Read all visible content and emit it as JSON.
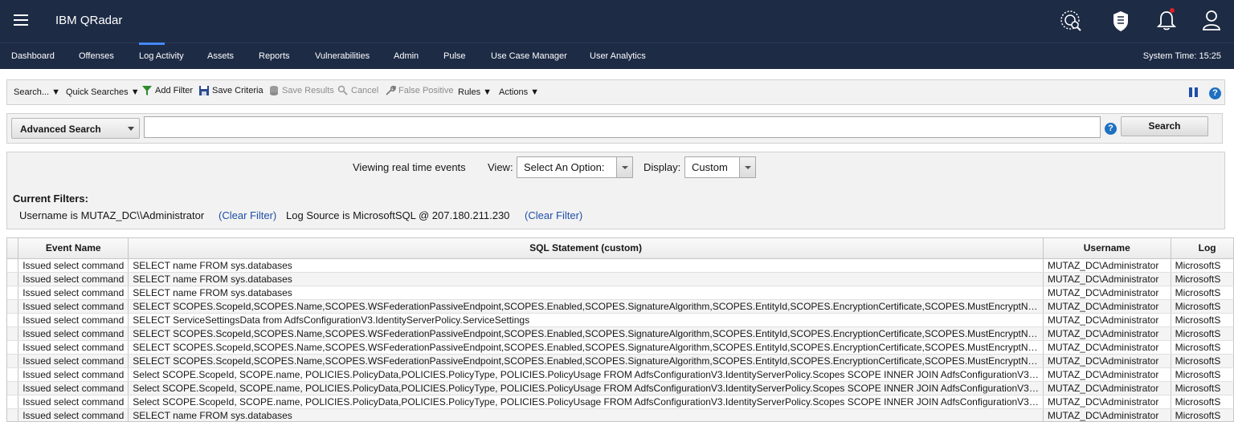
{
  "app": {
    "title": "IBM QRadar"
  },
  "header_icons": [
    "watson-globe-icon",
    "security-shield-icon",
    "notification-bell-icon",
    "user-profile-icon"
  ],
  "nav": {
    "items": [
      "Dashboard",
      "Offenses",
      "Log Activity",
      "Assets",
      "Reports",
      "Vulnerabilities",
      "Admin",
      "Pulse",
      "Use Case Manager",
      "User Analytics"
    ],
    "active": "Log Activity",
    "system_time": "System Time: 15:25"
  },
  "toolbar": {
    "search": "Search... ▼",
    "quick_searches": "Quick Searches ▼",
    "add_filter": "Add Filter",
    "save_criteria": "Save Criteria",
    "save_results": "Save Results",
    "cancel": "Cancel",
    "false_positive": "False Positive",
    "rules": "Rules ▼",
    "actions": "Actions ▼"
  },
  "search_bar": {
    "mode": "Advanced Search",
    "query": "",
    "button": "Search",
    "help": "?"
  },
  "filters": {
    "status": "Viewing real time events",
    "view_label": "View:",
    "view_value": "Select An Option:",
    "display_label": "Display:",
    "display_value": "Custom",
    "current_label": "Current Filters:",
    "filter1": "Username is MUTAZ_DC\\\\Administrator",
    "filter2": "Log Source is MicrosoftSQL @ 207.180.211.230",
    "clear": "(Clear Filter)"
  },
  "table": {
    "columns": [
      "Event Name",
      "SQL Statement (custom)",
      "Username",
      "Log"
    ],
    "rows": [
      [
        "Issued select command",
        "SELECT name FROM sys.databases",
        "MUTAZ_DC\\Administrator",
        "MicrosoftS"
      ],
      [
        "Issued select command",
        "SELECT name FROM sys.databases",
        "MUTAZ_DC\\Administrator",
        "MicrosoftS"
      ],
      [
        "Issued select command",
        "SELECT name FROM sys.databases",
        "MUTAZ_DC\\Administrator",
        "MicrosoftS"
      ],
      [
        "Issued select command",
        "SELECT SCOPES.ScopeId,SCOPES.Name,SCOPES.WSFederationPassiveEndpoint,SCOPES.Enabled,SCOPES.SignatureAlgorithm,SCOPES.EntityId,SCOPES.EncryptionCertificate,SCOPES.MustEncryptN…",
        "MUTAZ_DC\\Administrator",
        "MicrosoftS"
      ],
      [
        "Issued select command",
        "SELECT ServiceSettingsData from AdfsConfigurationV3.IdentityServerPolicy.ServiceSettings",
        "MUTAZ_DC\\Administrator",
        "MicrosoftS"
      ],
      [
        "Issued select command",
        "SELECT SCOPES.ScopeId,SCOPES.Name,SCOPES.WSFederationPassiveEndpoint,SCOPES.Enabled,SCOPES.SignatureAlgorithm,SCOPES.EntityId,SCOPES.EncryptionCertificate,SCOPES.MustEncryptN…",
        "MUTAZ_DC\\Administrator",
        "MicrosoftS"
      ],
      [
        "Issued select command",
        "SELECT SCOPES.ScopeId,SCOPES.Name,SCOPES.WSFederationPassiveEndpoint,SCOPES.Enabled,SCOPES.SignatureAlgorithm,SCOPES.EntityId,SCOPES.EncryptionCertificate,SCOPES.MustEncryptN…",
        "MUTAZ_DC\\Administrator",
        "MicrosoftS"
      ],
      [
        "Issued select command",
        "SELECT SCOPES.ScopeId,SCOPES.Name,SCOPES.WSFederationPassiveEndpoint,SCOPES.Enabled,SCOPES.SignatureAlgorithm,SCOPES.EntityId,SCOPES.EncryptionCertificate,SCOPES.MustEncryptN…",
        "MUTAZ_DC\\Administrator",
        "MicrosoftS"
      ],
      [
        "Issued select command",
        "Select SCOPE.ScopeId, SCOPE.name, POLICIES.PolicyData,POLICIES.PolicyType, POLICIES.PolicyUsage FROM AdfsConfigurationV3.IdentityServerPolicy.Scopes SCOPE INNER JOIN AdfsConfigurationV3…",
        "MUTAZ_DC\\Administrator",
        "MicrosoftS"
      ],
      [
        "Issued select command",
        "Select SCOPE.ScopeId, SCOPE.name, POLICIES.PolicyData,POLICIES.PolicyType, POLICIES.PolicyUsage FROM AdfsConfigurationV3.IdentityServerPolicy.Scopes SCOPE INNER JOIN AdfsConfigurationV3…",
        "MUTAZ_DC\\Administrator",
        "MicrosoftS"
      ],
      [
        "Issued select command",
        "Select SCOPE.ScopeId, SCOPE.name, POLICIES.PolicyData,POLICIES.PolicyType, POLICIES.PolicyUsage FROM AdfsConfigurationV3.IdentityServerPolicy.Scopes SCOPE INNER JOIN AdfsConfigurationV3…",
        "MUTAZ_DC\\Administrator",
        "MicrosoftS"
      ],
      [
        "Issued select command",
        "SELECT name FROM sys.databases",
        "MUTAZ_DC\\Administrator",
        "MicrosoftS"
      ]
    ]
  },
  "colors": {
    "header_bg": "#1d2b45",
    "accent": "#4589ff",
    "link": "#1f4fa8"
  }
}
